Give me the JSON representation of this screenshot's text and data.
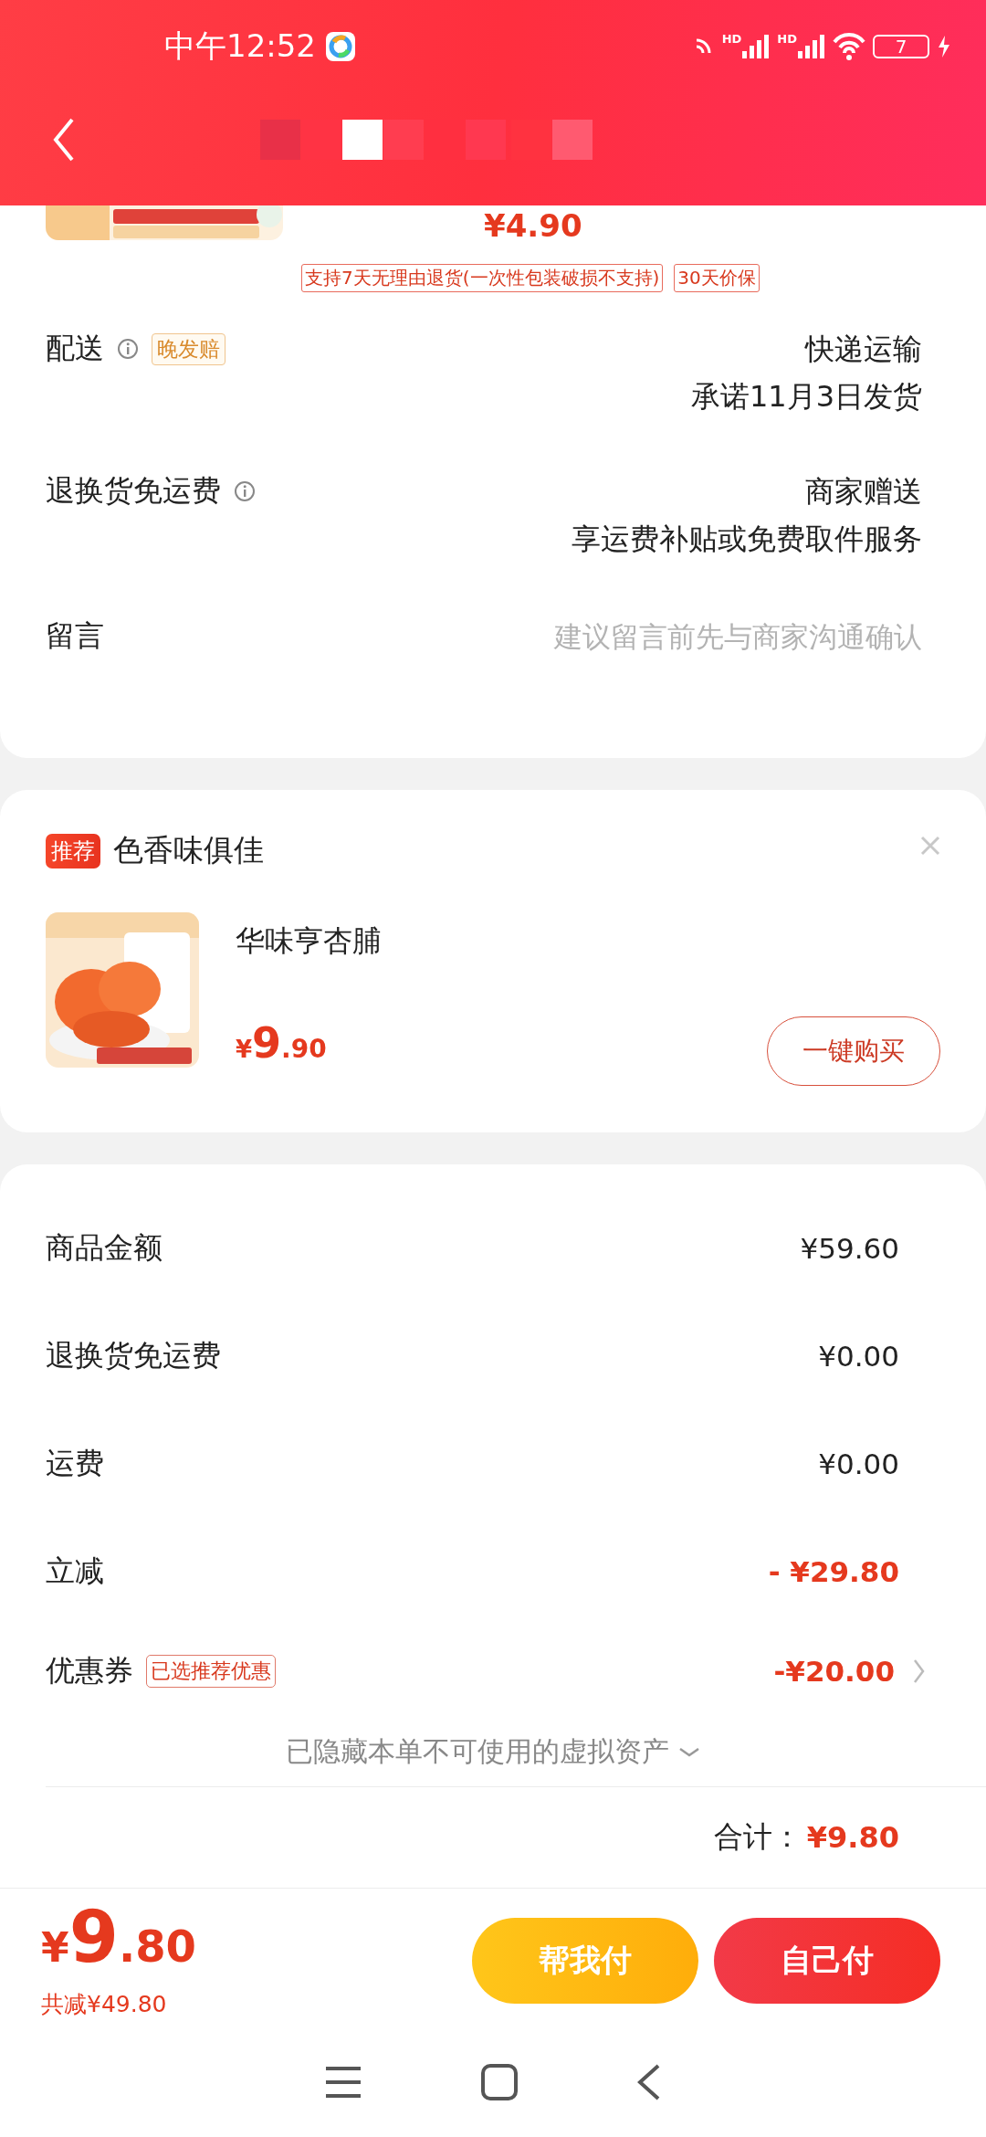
{
  "status_bar": {
    "time": "中午12:52",
    "network_labels": [
      "HD",
      "HD"
    ],
    "battery": "7"
  },
  "product_partial": {
    "price": "¥4.90",
    "service_tags": [
      "支持7天无理由退货(一次性包装破损不支持)",
      "30天价保"
    ]
  },
  "delivery_rows": [
    {
      "label": "配送",
      "info": true,
      "tag": "晚发赔",
      "lines": [
        "快递运输",
        "承诺11月3日发货"
      ]
    },
    {
      "label": "退换货免运费",
      "info": true,
      "lines": [
        "商家赠送",
        "享运费补贴或免费取件服务"
      ]
    }
  ],
  "message": {
    "label": "留言",
    "placeholder": "建议留言前先与商家沟通确认"
  },
  "recommend": {
    "badge": "推荐",
    "title": "色香味俱佳",
    "product": {
      "kind": "picture",
      "name": "华味亨杏脯",
      "currency": "¥",
      "price_int": "9",
      "price_dec": ".90",
      "button": "一键购买"
    }
  },
  "summary": {
    "rows": [
      {
        "label": "商品金额",
        "value": "¥59.60",
        "highlight": false,
        "chevron": false
      },
      {
        "label": "退换货免运费",
        "value": "¥0.00",
        "highlight": false,
        "chevron": false
      },
      {
        "label": "运费",
        "value": "¥0.00",
        "highlight": false,
        "chevron": false
      },
      {
        "label": "立减",
        "value": "- ¥29.80",
        "highlight": true,
        "chevron": false
      },
      {
        "label": "优惠券",
        "tag": "已选推荐优惠",
        "value": "-¥20.00",
        "highlight": true,
        "chevron": true
      }
    ],
    "hidden_note": "已隐藏本单不可使用的虚拟资产",
    "total_label": "合计：",
    "total_value": "¥9.80"
  },
  "footer": {
    "currency": "¥",
    "price_int": "9",
    "price_dec": ".80",
    "saved": "共减¥49.80",
    "buttons": [
      {
        "label": "帮我付",
        "kind": "secondary"
      },
      {
        "label": "自己付",
        "kind": "primary"
      }
    ]
  }
}
